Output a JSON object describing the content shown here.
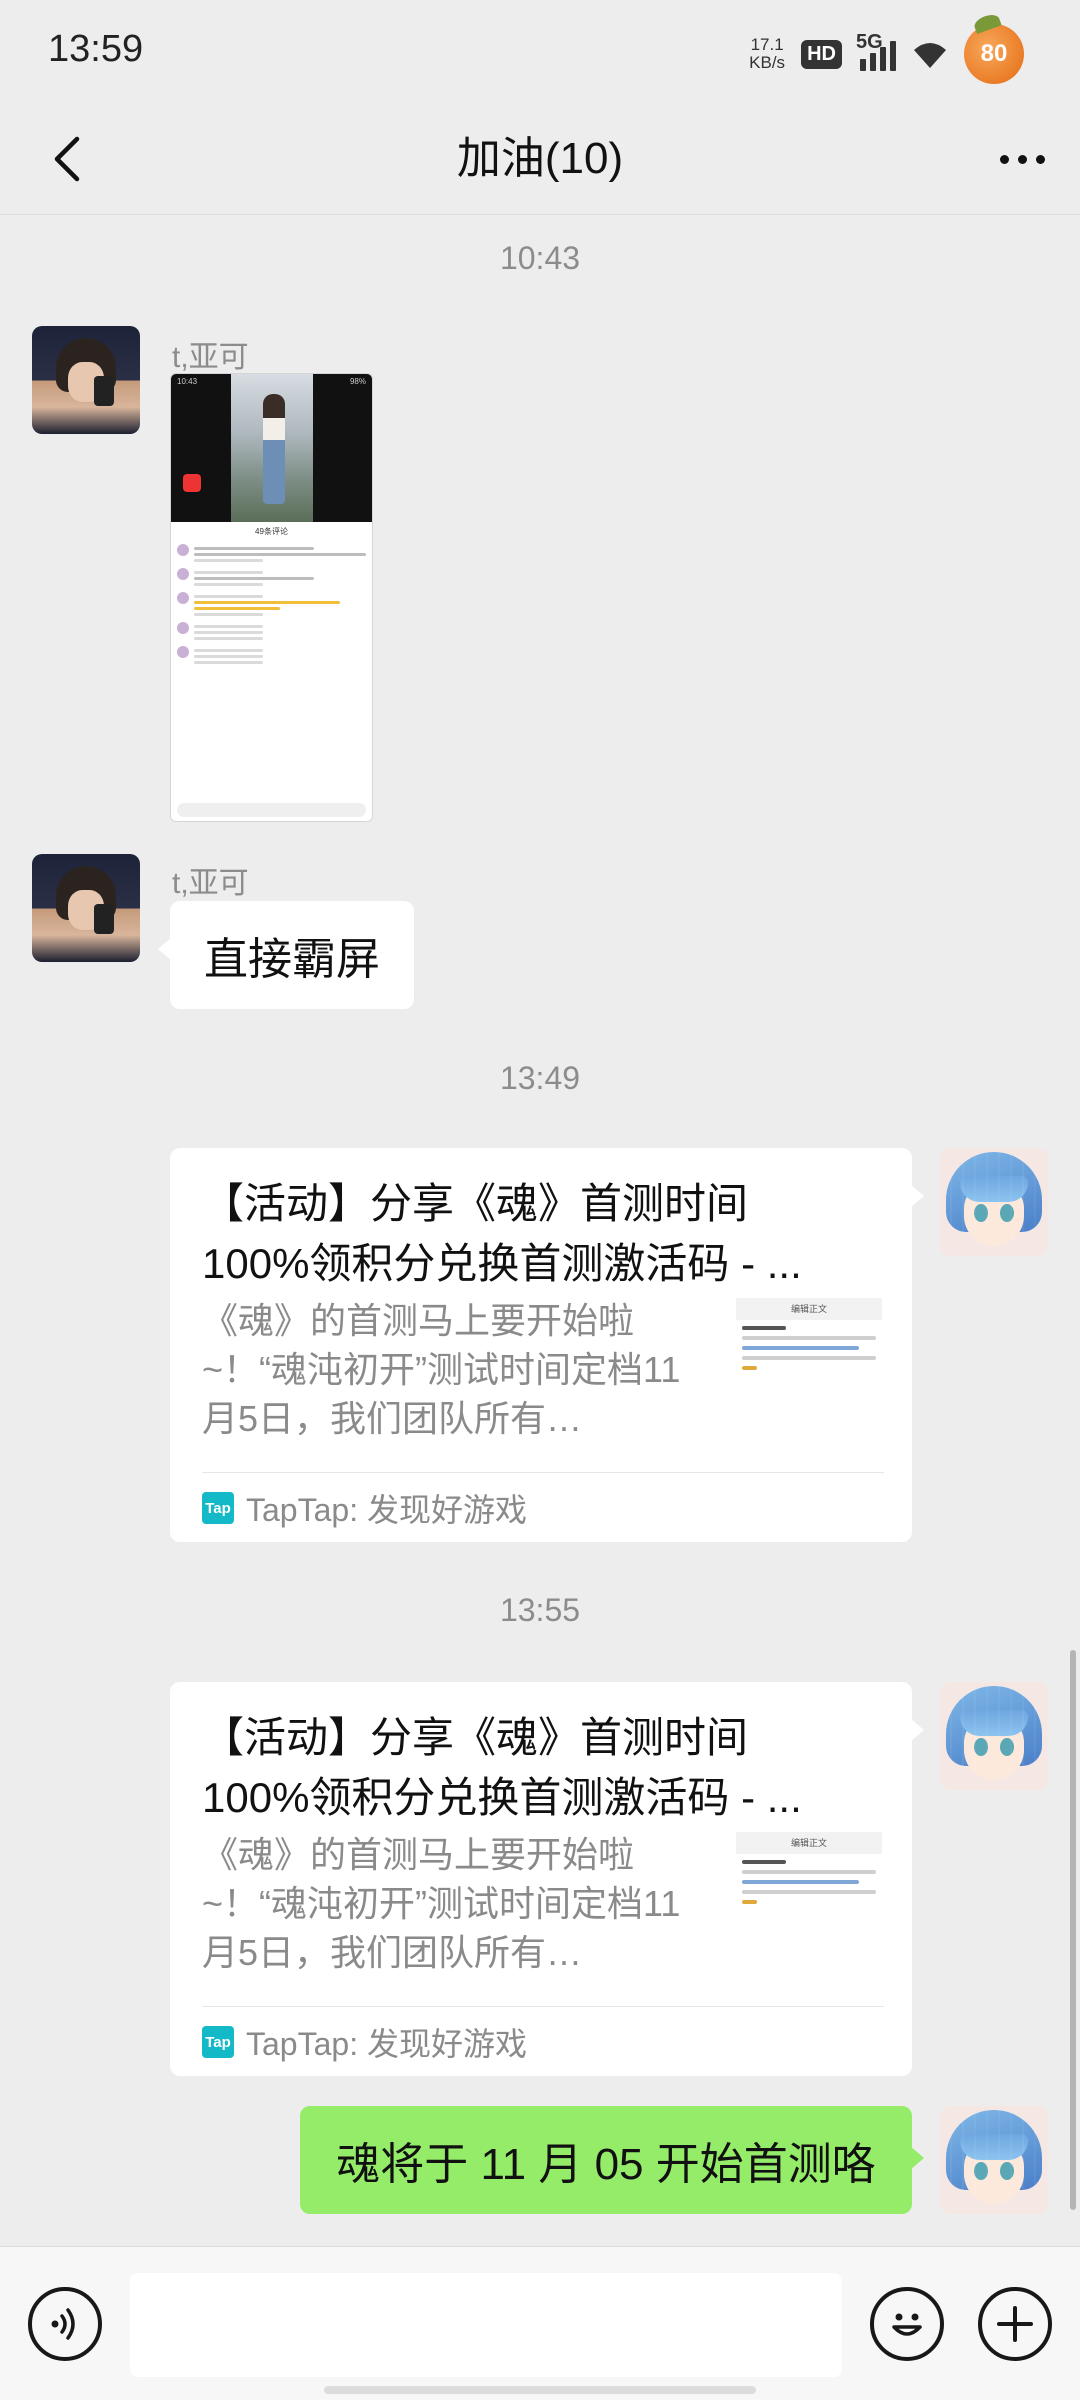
{
  "status_bar": {
    "time": "13:59",
    "net_speed_value": "17.1",
    "net_speed_unit": "KB/s",
    "hd_label": "HD",
    "network_label": "5G",
    "battery_level": "80"
  },
  "header": {
    "title": "加油(10)",
    "back_icon": "chevron-left-icon",
    "more_icon": "more-dots-icon"
  },
  "messages": [
    {
      "type": "timestamp",
      "text": "10:43"
    },
    {
      "type": "image",
      "sender": "t,亚可",
      "side": "left",
      "image_content": {
        "status_time": "10:43",
        "status_battery": "98%",
        "panel_title": "49条评论"
      }
    },
    {
      "type": "text",
      "sender": "t,亚可",
      "side": "left",
      "text": "直接霸屏"
    },
    {
      "type": "timestamp",
      "text": "13:49"
    },
    {
      "type": "link",
      "side": "right",
      "title_line1": "【活动】分享《魂》首测时间",
      "title_line2": "100%领积分兑换首测激活码 - ...",
      "desc": "《魂》的首测马上要开始啦~！“魂沌初开”测试时间定档11月5日，我们团队所有…",
      "thumb_title": "编辑正文",
      "source_icon": "Tap",
      "source": "TapTap: 发现好游戏"
    },
    {
      "type": "timestamp",
      "text": "13:55"
    },
    {
      "type": "link",
      "side": "right",
      "title_line1": "【活动】分享《魂》首测时间",
      "title_line2": "100%领积分兑换首测激活码 - ...",
      "desc": "《魂》的首测马上要开始啦~！“魂沌初开”测试时间定档11月5日，我们团队所有…",
      "thumb_title": "编辑正文",
      "source_icon": "Tap",
      "source": "TapTap: 发现好游戏"
    },
    {
      "type": "text",
      "side": "right",
      "text": "魂将于 11 月 05 开始首测咯"
    }
  ],
  "input_bar": {
    "voice_icon": "voice-icon",
    "input_value": "",
    "emoji_icon": "emoji-icon",
    "plus_icon": "plus-icon"
  },
  "colors": {
    "background": "#ededed",
    "my_bubble": "#95ec69",
    "other_bubble": "#ffffff",
    "taptap_brand": "#14b9c8"
  }
}
